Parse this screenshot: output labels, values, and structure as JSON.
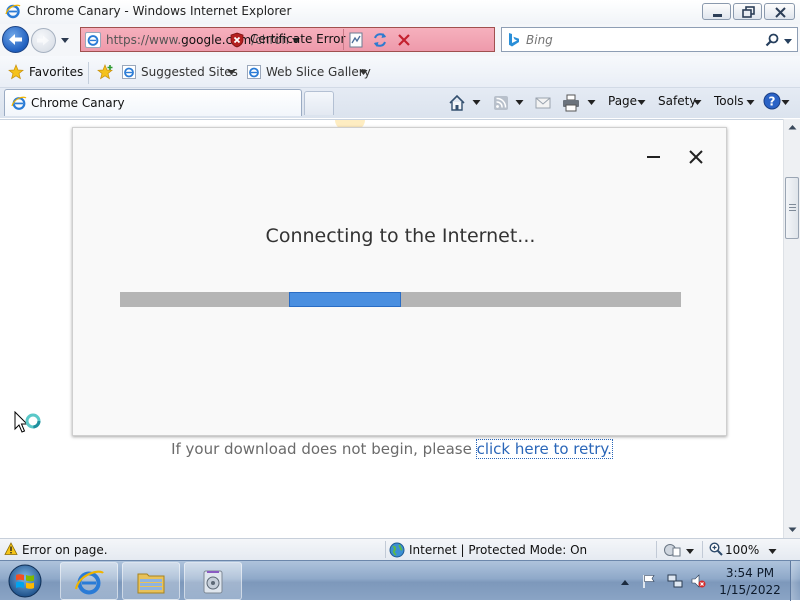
{
  "window": {
    "title": "Chrome Canary - Windows Internet Explorer"
  },
  "address_bar": {
    "url_scheme": "https://www.",
    "url_domain": "google.com",
    "url_path": "/chrome",
    "certificate_error": "Certificate Error"
  },
  "search": {
    "placeholder": "Bing"
  },
  "favorites_bar": {
    "favorites_label": "Favorites",
    "links": [
      {
        "label": "Suggested Sites"
      },
      {
        "label": "Web Slice Gallery"
      }
    ]
  },
  "tabs": [
    {
      "label": "Chrome Canary",
      "active": true
    }
  ],
  "command_bar": {
    "page": "Page",
    "safety": "Safety",
    "tools": "Tools"
  },
  "dialog": {
    "message": "Connecting to the Internet...",
    "progress_fraction": 0.2
  },
  "retry": {
    "prefix": "If your download does not begin, please ",
    "link": "click here to retry."
  },
  "status_bar": {
    "status": "Error on page.",
    "zone": "Internet | Protected Mode: On",
    "zoom": "100%"
  },
  "taskbar": {
    "time": "3:54 PM",
    "date": "1/15/2022"
  },
  "colors": {
    "address_error_bg": "#f0a0b0",
    "progress_fill": "#4a8fe0",
    "progress_track": "#b5b5b5",
    "link": "#2a66b8"
  },
  "icons": {
    "title": "ie-icon",
    "back": "back-arrow-icon",
    "forward": "forward-arrow-icon",
    "certificate": "certificate-error-icon",
    "refresh": "refresh-icon",
    "stop": "stop-icon",
    "search": "search-icon",
    "home": "home-icon",
    "feeds": "rss-feed-icon",
    "mail": "mail-icon",
    "print": "print-icon",
    "help": "help-icon",
    "dialog_minimize": "minimize-icon",
    "dialog_close": "close-icon"
  }
}
